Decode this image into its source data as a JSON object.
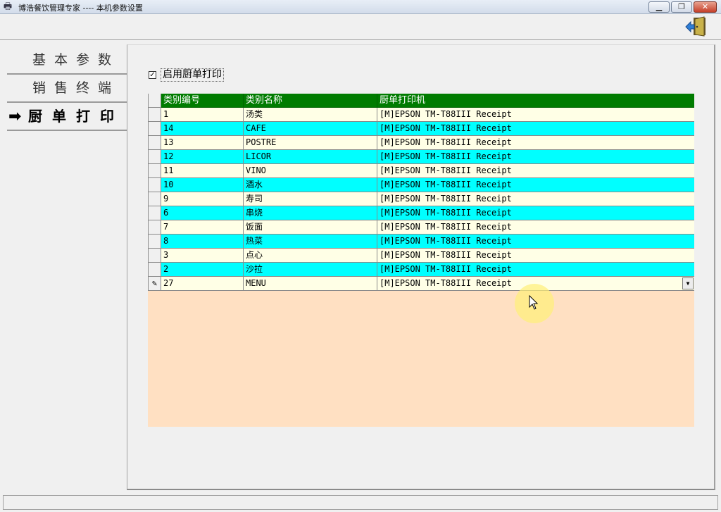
{
  "window": {
    "title": "博浩餐饮管理专家 ---- 本机参数设置",
    "app_icon": "printer-icon",
    "buttons": [
      "minimize-icon",
      "restore-icon",
      "close-icon"
    ]
  },
  "toolbar": {
    "exit_icon": "exit-door-icon"
  },
  "nav": {
    "items": [
      {
        "label": "基本参数"
      },
      {
        "label": "销售终端"
      },
      {
        "label": "厨单打印",
        "active": true
      }
    ],
    "arrow": "➡"
  },
  "settings": {
    "enable_kitchen_print_label": "启用厨单打印",
    "enable_kitchen_print_checked": true,
    "check_mark": "✓"
  },
  "grid": {
    "columns": [
      "类别编号",
      "类别名称",
      "厨单打印机"
    ],
    "rows": [
      {
        "id": "1",
        "name": "汤类",
        "printer": "[M]EPSON TM-T88III Receipt"
      },
      {
        "id": "14",
        "name": "CAFE",
        "printer": "[M]EPSON TM-T88III Receipt"
      },
      {
        "id": "13",
        "name": "POSTRE",
        "printer": "[M]EPSON TM-T88III Receipt"
      },
      {
        "id": "12",
        "name": "LICOR",
        "printer": "[M]EPSON TM-T88III Receipt"
      },
      {
        "id": "11",
        "name": "VINO",
        "printer": "[M]EPSON TM-T88III Receipt"
      },
      {
        "id": "10",
        "name": "酒水",
        "printer": "[M]EPSON TM-T88III Receipt"
      },
      {
        "id": "9",
        "name": "寿司",
        "printer": "[M]EPSON TM-T88III Receipt"
      },
      {
        "id": "6",
        "name": "串烧",
        "printer": "[M]EPSON TM-T88III Receipt"
      },
      {
        "id": "7",
        "name": "饭面",
        "printer": "[M]EPSON TM-T88III Receipt"
      },
      {
        "id": "8",
        "name": "热菜",
        "printer": "[M]EPSON TM-T88III Receipt"
      },
      {
        "id": "3",
        "name": "点心",
        "printer": "[M]EPSON TM-T88III Receipt"
      },
      {
        "id": "2",
        "name": "沙拉",
        "printer": "[M]EPSON TM-T88III Receipt"
      },
      {
        "id": "27",
        "name": "MENU",
        "printer": "[M]EPSON TM-T88III Receipt",
        "editing": true
      }
    ],
    "edit_marker": "✎",
    "colors": {
      "header": "#007c00",
      "row_odd": "#ffffe6",
      "row_even": "#00ffff",
      "empty_area": "#ffe0c2"
    }
  },
  "statusbar": {
    "text": ""
  }
}
